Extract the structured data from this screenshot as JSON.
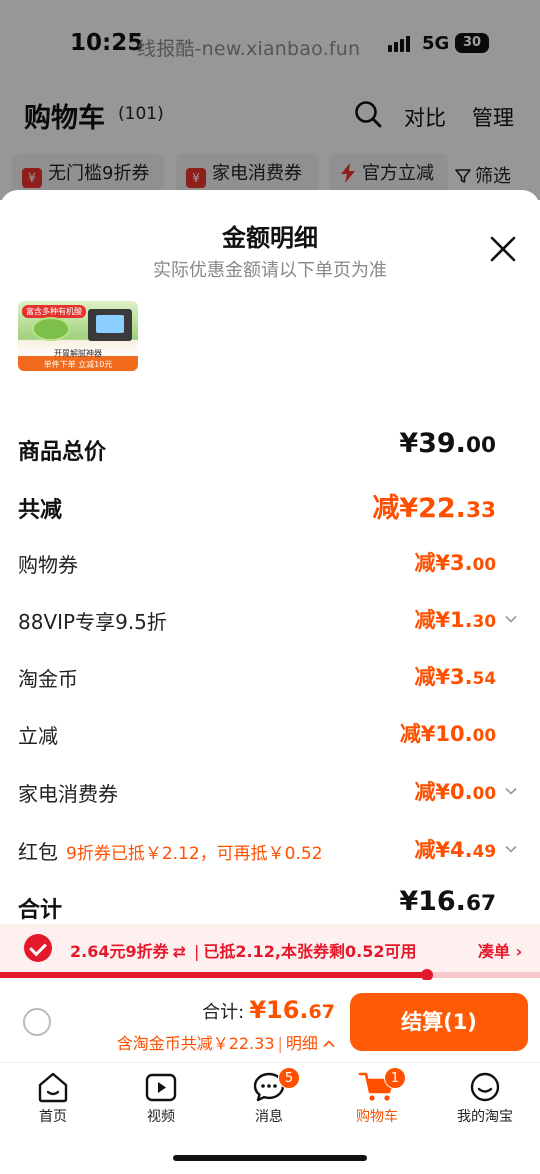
{
  "status_bar": {
    "time": "10:25",
    "watermark": "线报酷-new.xianbao.fun",
    "network": "5G",
    "battery": "30"
  },
  "cart_header": {
    "title": "购物车",
    "count": "(101)",
    "search_icon": "search-icon",
    "compare": "对比",
    "manage": "管理"
  },
  "filters": {
    "chips": [
      "无门槛9折券",
      "家电消费券",
      "官方立减"
    ],
    "coupon_icon_text": "¥",
    "filter_label": "筛选"
  },
  "sheet": {
    "title": "金额明细",
    "subtitle": "实际优惠金额请以下单页为准",
    "product_thumb": {
      "tag": "富含多种有机酸",
      "line1": "开胃解腻神器",
      "line2": "单件下单 立减10元"
    },
    "rows": [
      {
        "label": "商品总价",
        "amount_main": "¥39.",
        "amount_dec": "00"
      },
      {
        "label": "共减",
        "amount_main": "减¥22.",
        "amount_dec": "33"
      },
      {
        "label": "购物券",
        "amount_main": "减¥3.",
        "amount_dec": "00"
      },
      {
        "label": "88VIP专享9.5折",
        "amount_main": "减¥1.",
        "amount_dec": "30"
      },
      {
        "label": "淘金币",
        "amount_main": "减¥3.",
        "amount_dec": "54"
      },
      {
        "label": "立减",
        "amount_main": "减¥10.",
        "amount_dec": "00"
      },
      {
        "label": "家电消费券",
        "amount_main": "减¥0.",
        "amount_dec": "00"
      },
      {
        "label": "红包",
        "note": "9折券已抵￥2.12，可再抵￥0.52",
        "amount_main": "减¥4.",
        "amount_dec": "49"
      },
      {
        "label": "合计",
        "amount_main": "¥16.",
        "amount_dec": "67"
      }
    ]
  },
  "coupon_bar": {
    "part1": "2.64元9折券",
    "swap_icon": "⇄",
    "part2": "已抵2.12,本张券剩0.52可用",
    "link": "凑单",
    "progress_fraction": 0.79
  },
  "checkout": {
    "total_label": "合计:",
    "total_main": "¥16.",
    "total_dec": "67",
    "discount_text": "含淘金币共减￥22.33",
    "detail_label": "明细",
    "button_label": "结算(1)"
  },
  "tabbar": {
    "tabs": [
      {
        "label": "首页",
        "icon": "home-icon"
      },
      {
        "label": "视频",
        "icon": "video-icon"
      },
      {
        "label": "消息",
        "icon": "message-icon",
        "badge": "5"
      },
      {
        "label": "购物车",
        "icon": "cart-icon",
        "badge": "1"
      },
      {
        "label": "我的淘宝",
        "icon": "profile-icon"
      }
    ]
  },
  "colors": {
    "accent_orange": "#ff5000",
    "accent_red": "#e5192c",
    "checkout_button": "#ff5a05"
  }
}
